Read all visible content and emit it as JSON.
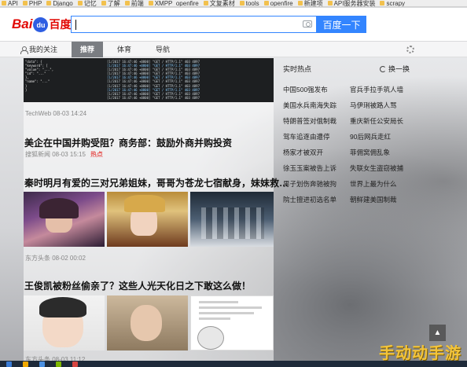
{
  "bookmarks": [
    "API",
    "PHP",
    "Django",
    "记忆",
    "了解",
    "前端",
    "XMPP_openfire",
    "文复素材",
    "tools",
    "openfire",
    "新建项",
    "API服务器安装",
    "scrapy"
  ],
  "logo": {
    "latin": "Bai",
    "paw": "du",
    "chinese": "百度"
  },
  "search": {
    "value": "",
    "button_label": "百度一下"
  },
  "nav": {
    "mine": "我的关注",
    "tabs": [
      "推荐",
      "体育",
      "导航"
    ],
    "active_tab": "推荐"
  },
  "feed": {
    "terminal_lines_left": [
      "  \"data\": {",
      "    \"keyword\": [",
      "      \"value\": \"...\",",
      "      \"id\": \"...\"",
      "    },",
      "    \"name\": \"...\"",
      "  }",
      "}"
    ],
    "terminal_lines_right": [
      "[1/2017 16:47:46 +0800] \"GET / HTTP/1.1\" 403 4897",
      "[1/2017 16:47:46 +0800] \"GET / HTTP/1.1\" 403 4897",
      "[1/2017 16:47:46 +0800] \"GET / HTTP/1.1\" 403 4897",
      "[1/2017 16:47:46 +0800] \"GET / HTTP/1.1\" 403 4897",
      "[1/2017 16:47:46 +0800] \"GET / HTTP/1.1\" 403 4897",
      "[1/2017 16:47:46 +0800] \"GET / HTTP/1.1\" 403 4897",
      "[1/2017 16:47:46 +0800] \"GET / HTTP/1.1\" 403 4897",
      "[1/2017 16:47:46 +0800] \"GET / HTTP/1.1\" 403 4897",
      "[1/2017 16:47:46 +0800] \"GET / HTTP/1.1\" 403 4897",
      "[1/2017 16:47:46 +0800] \"GET / HTTP/1.1\" 403 4897"
    ],
    "item1_meta": "TechWeb  08-03 14:24",
    "item2_title": "美企在中国并购受阻？商务部：鼓励外商并购投资",
    "item2_meta": "搜狐新闻  08-03 15:15",
    "item2_badge": "热点",
    "item3_title": "秦时明月有爱的三对兄弟姐妹，哥哥为苍龙七宿献身，妹妹救…",
    "item3_meta": "东方头条  08-02 00:02",
    "item4_title": "王俊凯被粉丝偷亲了？这些人光天化日之下敢这么做！",
    "item4_meta": "东方头条  08-03 11:12"
  },
  "hotlist": {
    "title": "实时热点",
    "swap": "换一换",
    "items": [
      [
        "中国500强发布",
        "官兵手拉手筑人墙"
      ],
      [
        "美国水兵南海失踪",
        "马伊琍被路人骂"
      ],
      [
        "特朗普签对俄制裁",
        "重庆新任公安局长"
      ],
      [
        "驾车追逐由遭停",
        "90后网兵走红"
      ],
      [
        "杨家才被双开",
        "菲佣窝佣乱象"
      ],
      [
        "徐玉玉案被告上诉",
        "失联女生盗窃被捕"
      ],
      [
        "男子划伤奔驰被拘",
        "世界上最为什么"
      ],
      [
        "院士擅进初选名单",
        "朝鲜建美国制裁"
      ]
    ]
  },
  "watermark": "手动动手游",
  "colors": {
    "accent": "#3385ff",
    "brand_red": "#e10602",
    "nav_active": "#7a7d82"
  }
}
